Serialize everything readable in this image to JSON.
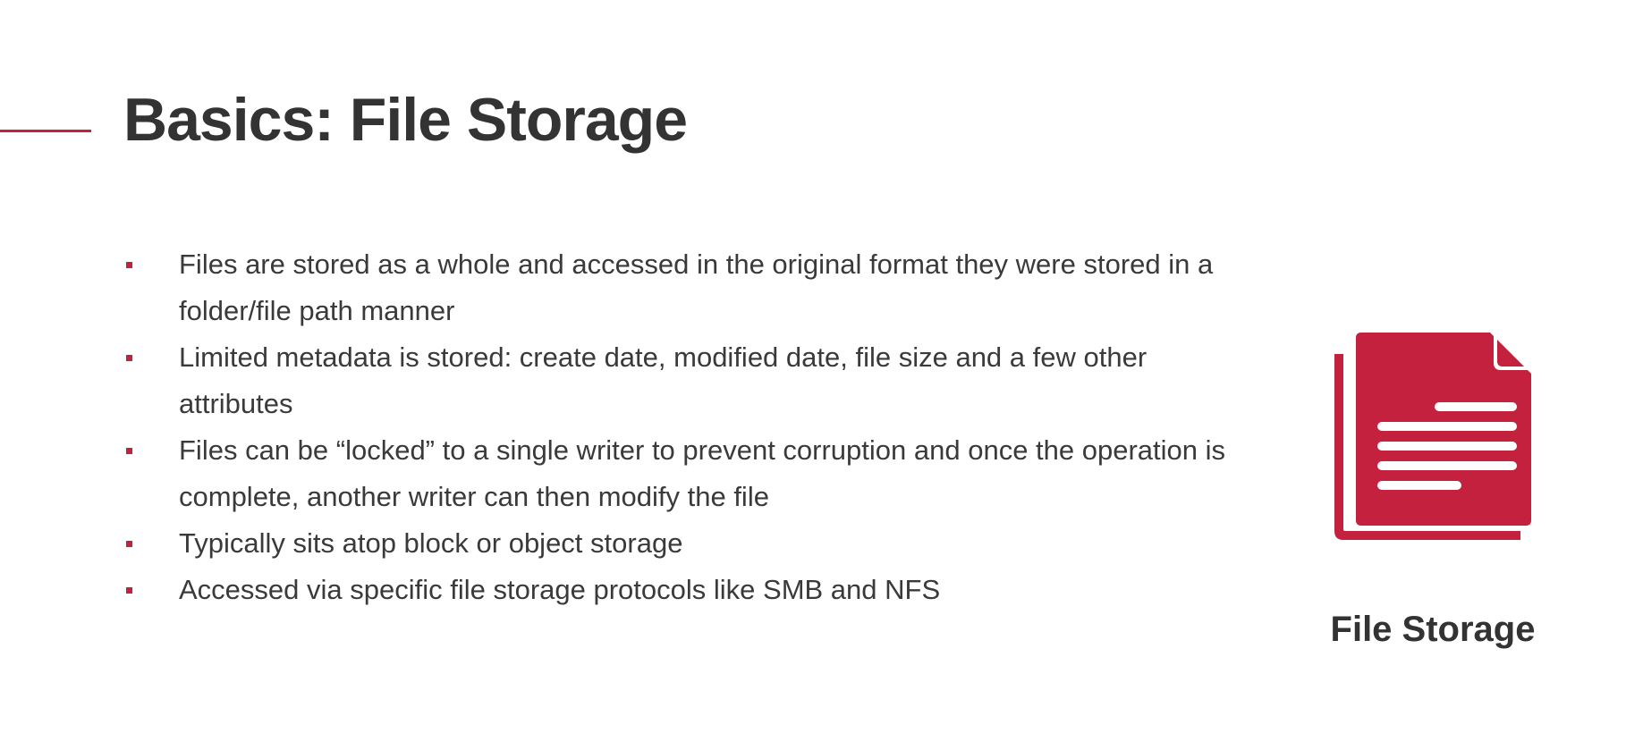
{
  "slide": {
    "title": "Basics: File Storage",
    "bullets": [
      "Files are stored as a whole and accessed in the original format they were stored in a folder/file path manner",
      "Limited metadata is stored: create date, modified date, file size and a few other attributes",
      "Files can be “locked” to a single writer to prevent corruption and once the operation is complete, another writer can then modify the file",
      "Typically sits atop block or object storage",
      "Accessed via specific file storage protocols like SMB and NFS"
    ],
    "icon": {
      "name": "file-document-icon",
      "caption": "File Storage",
      "color": "#c4213f"
    }
  },
  "colors": {
    "accent": "#c4213f",
    "title": "#333333",
    "body": "#3a3a3a",
    "background": "#ffffff"
  }
}
